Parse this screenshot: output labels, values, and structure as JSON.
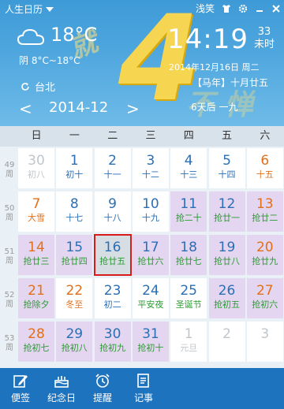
{
  "app": {
    "name": "人生日历",
    "topbar_text": "浅笑"
  },
  "weather": {
    "icon": "cloud-icon",
    "temperature": "18°C",
    "condition_range": "阴 8°C~18°C",
    "city": "台北"
  },
  "clock": {
    "time": "14:19",
    "seconds": "33",
    "seconds_label": "未时",
    "date": "2014年12月16日 周二",
    "lunar": "【马年】十月廿五",
    "jieqi": "6天后 一九"
  },
  "decoration": {
    "big_digit": "4",
    "left_char": "就",
    "right_chars": "不 惮"
  },
  "month_nav": {
    "prev": "<",
    "label": "2014-12",
    "next": ">"
  },
  "weekdays": [
    "日",
    "一",
    "二",
    "三",
    "四",
    "五",
    "六"
  ],
  "weeks": [
    {
      "week_no": "49",
      "week_label": "周",
      "days": [
        {
          "n": "30",
          "l": "初八",
          "cls": "c-gray",
          "bg": "plain"
        },
        {
          "n": "1",
          "l": "初十",
          "cls": "c-blue",
          "bg": "plain"
        },
        {
          "n": "2",
          "l": "十一",
          "cls": "c-blue",
          "bg": "plain"
        },
        {
          "n": "3",
          "l": "十二",
          "cls": "c-blue",
          "bg": "plain"
        },
        {
          "n": "4",
          "l": "十三",
          "cls": "c-blue",
          "bg": "plain"
        },
        {
          "n": "5",
          "l": "十四",
          "cls": "c-blue",
          "bg": "plain"
        },
        {
          "n": "6",
          "l": "十五",
          "cls": "c-sat",
          "bg": "plain"
        }
      ]
    },
    {
      "week_no": "50",
      "week_label": "周",
      "days": [
        {
          "n": "7",
          "l": "大雪",
          "cls": "c-orange",
          "bg": "plain"
        },
        {
          "n": "8",
          "l": "十七",
          "cls": "c-blue",
          "bg": "plain"
        },
        {
          "n": "9",
          "l": "十八",
          "cls": "c-blue",
          "bg": "plain"
        },
        {
          "n": "10",
          "l": "十九",
          "cls": "c-blue",
          "bg": "plain"
        },
        {
          "n": "11",
          "l": "抢二十",
          "cls": "c-green",
          "bg": "purple"
        },
        {
          "n": "12",
          "l": "抢廿一",
          "cls": "c-green",
          "bg": "purple"
        },
        {
          "n": "13",
          "l": "抢廿二",
          "cls": "c-green",
          "bg": "purple"
        }
      ]
    },
    {
      "week_no": "51",
      "week_label": "周",
      "days": [
        {
          "n": "14",
          "l": "抢廿三",
          "cls": "c-green",
          "bg": "purple"
        },
        {
          "n": "15",
          "l": "抢廿四",
          "cls": "c-green",
          "bg": "purple"
        },
        {
          "n": "16",
          "l": "抢廿五",
          "cls": "c-green",
          "bg": "selected"
        },
        {
          "n": "17",
          "l": "抢廿六",
          "cls": "c-green",
          "bg": "purple"
        },
        {
          "n": "18",
          "l": "抢廿七",
          "cls": "c-green",
          "bg": "purple"
        },
        {
          "n": "19",
          "l": "抢廿八",
          "cls": "c-green",
          "bg": "purple"
        },
        {
          "n": "20",
          "l": "抢廿九",
          "cls": "c-green",
          "bg": "purple"
        }
      ]
    },
    {
      "week_no": "52",
      "week_label": "周",
      "days": [
        {
          "n": "21",
          "l": "抢除夕",
          "cls": "c-green",
          "bg": "purple"
        },
        {
          "n": "22",
          "l": "冬至",
          "cls": "c-orange",
          "bg": "plain"
        },
        {
          "n": "23",
          "l": "初二",
          "cls": "c-blue",
          "bg": "plain"
        },
        {
          "n": "24",
          "l": "平安夜",
          "cls": "c-green",
          "bg": "plain"
        },
        {
          "n": "25",
          "l": "圣诞节",
          "cls": "c-green",
          "bg": "plain"
        },
        {
          "n": "26",
          "l": "抢初五",
          "cls": "c-green",
          "bg": "purple"
        },
        {
          "n": "27",
          "l": "抢初六",
          "cls": "c-green",
          "bg": "purple"
        }
      ]
    },
    {
      "week_no": "53",
      "week_label": "周",
      "days": [
        {
          "n": "28",
          "l": "抢初七",
          "cls": "c-green",
          "bg": "purple"
        },
        {
          "n": "29",
          "l": "抢初八",
          "cls": "c-green",
          "bg": "purple"
        },
        {
          "n": "30",
          "l": "抢初九",
          "cls": "c-green",
          "bg": "purple"
        },
        {
          "n": "31",
          "l": "抢初十",
          "cls": "c-green",
          "bg": "purple"
        },
        {
          "n": "1",
          "l": "元旦",
          "cls": "c-gray",
          "bg": "plain"
        },
        {
          "n": "2",
          "l": "",
          "cls": "c-gray",
          "bg": "plain"
        },
        {
          "n": "3",
          "l": "",
          "cls": "c-gray",
          "bg": "plain"
        }
      ]
    }
  ],
  "bottombar": [
    {
      "name": "bookmark-button",
      "icon": "pen-icon",
      "label": "便签"
    },
    {
      "name": "anniversary-button",
      "icon": "cake-icon",
      "label": "纪念日"
    },
    {
      "name": "reminder-button",
      "icon": "alarm-clock-icon",
      "label": "提醒"
    },
    {
      "name": "notes-button",
      "icon": "notepad-icon",
      "label": "记事"
    }
  ],
  "colors": {
    "header_blue": "#4ea6de",
    "accent_yellow": "#ffd84a",
    "bottom_bar": "#1e73bf",
    "selected_outline": "#d91a1a",
    "holiday_purple": "#e4d6f0"
  }
}
